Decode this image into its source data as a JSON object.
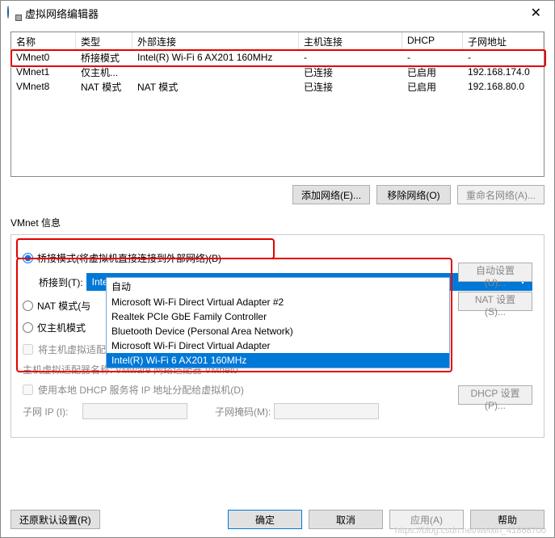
{
  "window": {
    "title": "虚拟网络编辑器"
  },
  "table": {
    "headers": [
      "名称",
      "类型",
      "外部连接",
      "主机连接",
      "DHCP",
      "子网地址"
    ],
    "rows": [
      {
        "name": "VMnet0",
        "type": "桥接模式",
        "ext": "Intel(R) Wi-Fi 6 AX201 160MHz",
        "host": "-",
        "dhcp": "-",
        "subnet": "-"
      },
      {
        "name": "VMnet1",
        "type": "仅主机...",
        "ext": "",
        "host": "已连接",
        "dhcp": "已启用",
        "subnet": "192.168.174.0"
      },
      {
        "name": "VMnet8",
        "type": "NAT 模式",
        "ext": "NAT 模式",
        "host": "已连接",
        "dhcp": "已启用",
        "subnet": "192.168.80.0"
      }
    ]
  },
  "buttons": {
    "add_network": "添加网络(E)...",
    "remove_network": "移除网络(O)",
    "rename_network": "重命名网络(A)...",
    "auto_settings": "自动设置(U)...",
    "nat_settings": "NAT 设置(S)...",
    "dhcp_settings": "DHCP 设置(P)...",
    "restore_defaults": "还原默认设置(R)",
    "ok": "确定",
    "cancel": "取消",
    "apply": "应用(A)",
    "help": "帮助"
  },
  "section": {
    "vmnet_info": "VMnet 信息"
  },
  "radios": {
    "bridged": "桥接模式(将虚拟机直接连接到外部网络)(B)",
    "bridged_to": "桥接到(T):",
    "nat": "NAT 模式(与虚拟机共享主机的 IP 地址)(N)",
    "hostonly": "仅主机模式(在专用网络内连接虚拟机)(H)"
  },
  "combo": {
    "selected": "Intel(R) Wi-Fi 6 AX201 160MHz",
    "options": [
      "自动",
      "Microsoft Wi-Fi Direct Virtual Adapter #2",
      "Realtek PCIe GbE Family Controller",
      "Bluetooth Device (Personal Area Network)",
      "Microsoft Wi-Fi Direct Virtual Adapter",
      "Intel(R) Wi-Fi 6 AX201 160MHz"
    ]
  },
  "host_adapter": {
    "connect_label": "将主机虚拟适配器连接到此网络(V)",
    "name_label": "主机虚拟适配器名称:",
    "name_value": "VMware 网络适配器 VMnet0"
  },
  "dhcp": {
    "label": "使用本地 DHCP 服务将 IP 地址分配给虚拟机(D)"
  },
  "ip": {
    "subnet_ip_label": "子网 IP (I):",
    "subnet_mask_label": "子网掩码(M):"
  },
  "watermark": "https://blog.csdn.net/weixin_41868700"
}
